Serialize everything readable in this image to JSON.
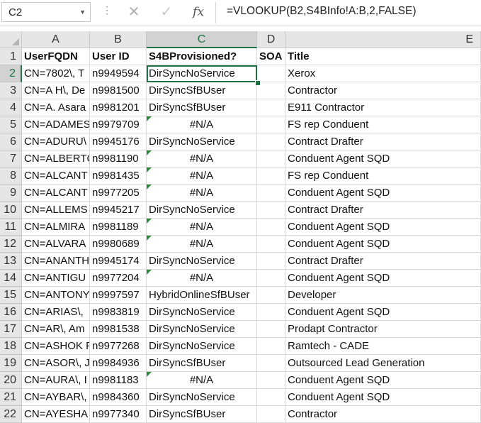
{
  "formula_bar": {
    "name_box": "C2",
    "formula": "=VLOOKUP(B2,S4BInfo!A:B,2,FALSE)",
    "fx_label": "fx",
    "cancel_glyph": "✕",
    "enter_glyph": "✓"
  },
  "columns": [
    "A",
    "B",
    "C",
    "D",
    "E"
  ],
  "rows": [
    {
      "n": "1",
      "a": "UserFQDN",
      "b": "User ID",
      "c": "S4BProvisioned?",
      "d": "SOA",
      "e": "Title",
      "header": true
    },
    {
      "n": "2",
      "a": "CN=7802\\, T",
      "b": "n9949594",
      "c": "DirSyncNoService",
      "d": "",
      "e": "Xerox"
    },
    {
      "n": "3",
      "a": "CN=A H\\, De",
      "b": "n9981500",
      "c": "DirSyncSfBUser",
      "d": "",
      "e": "Contractor"
    },
    {
      "n": "4",
      "a": "CN=A. Asara",
      "b": "n9981201",
      "c": "DirSyncSfBUser",
      "d": "",
      "e": "E911 Contractor"
    },
    {
      "n": "5",
      "a": "CN=ADAMES",
      "b": "n9979709",
      "c": "#N/A",
      "d": "",
      "e": "FS rep Conduent",
      "na": true
    },
    {
      "n": "6",
      "a": "CN=ADURU\\",
      "b": "n9945176",
      "c": "DirSyncNoService",
      "d": "",
      "e": "Contract Drafter"
    },
    {
      "n": "7",
      "a": "CN=ALBERTC",
      "b": "n9981190",
      "c": "#N/A",
      "d": "",
      "e": "Conduent Agent SQD",
      "na": true
    },
    {
      "n": "8",
      "a": "CN=ALCANT",
      "b": "n9981435",
      "c": "#N/A",
      "d": "",
      "e": "FS rep Conduent",
      "na": true
    },
    {
      "n": "9",
      "a": "CN=ALCANT",
      "b": "n9977205",
      "c": "#N/A",
      "d": "",
      "e": "Conduent Agent SQD",
      "na": true
    },
    {
      "n": "10",
      "a": "CN=ALLEMS",
      "b": "n9945217",
      "c": "DirSyncNoService",
      "d": "",
      "e": "Contract Drafter"
    },
    {
      "n": "11",
      "a": "CN=ALMIRA",
      "b": "n9981189",
      "c": "#N/A",
      "d": "",
      "e": "Conduent Agent SQD",
      "na": true
    },
    {
      "n": "12",
      "a": "CN=ALVARA",
      "b": "n9980689",
      "c": "#N/A",
      "d": "",
      "e": "Conduent Agent SQD",
      "na": true
    },
    {
      "n": "13",
      "a": "CN=ANANTH",
      "b": "n9945174",
      "c": "DirSyncNoService",
      "d": "",
      "e": "Contract Drafter"
    },
    {
      "n": "14",
      "a": "CN=ANTIGU",
      "b": "n9977204",
      "c": "#N/A",
      "d": "",
      "e": "Conduent Agent SQD",
      "na": true
    },
    {
      "n": "15",
      "a": "CN=ANTONY",
      "b": "n9997597",
      "c": "HybridOnlineSfBUser",
      "d": "",
      "e": "Developer"
    },
    {
      "n": "16",
      "a": "CN=ARIAS\\, ",
      "b": "n9983819",
      "c": "DirSyncNoService",
      "d": "",
      "e": "Conduent Agent SQD"
    },
    {
      "n": "17",
      "a": "CN=AR\\, Am",
      "b": "n9981538",
      "c": "DirSyncNoService",
      "d": "",
      "e": "Prodapt Contractor"
    },
    {
      "n": "18",
      "a": "CN=ASHOK F",
      "b": "n9977268",
      "c": "DirSyncNoService",
      "d": "",
      "e": "Ramtech - CADE"
    },
    {
      "n": "19",
      "a": "CN=ASOR\\, J",
      "b": "n9984936",
      "c": "DirSyncSfBUser",
      "d": "",
      "e": "Outsourced Lead Generation"
    },
    {
      "n": "20",
      "a": "CN=AURA\\, I",
      "b": "n9981183",
      "c": "#N/A",
      "d": "",
      "e": "Conduent Agent SQD",
      "na": true
    },
    {
      "n": "21",
      "a": "CN=AYBAR\\,",
      "b": "n9984360",
      "c": "DirSyncNoService",
      "d": "",
      "e": "Conduent Agent SQD"
    },
    {
      "n": "22",
      "a": "CN=AYESHA",
      "b": "n9977340",
      "c": "DirSyncSfBUser",
      "d": "",
      "e": "Contractor"
    }
  ],
  "colors": {
    "selection_green": "#217346",
    "error_flag": "#2e8b3c",
    "header_bg": "#e6e6e6"
  }
}
